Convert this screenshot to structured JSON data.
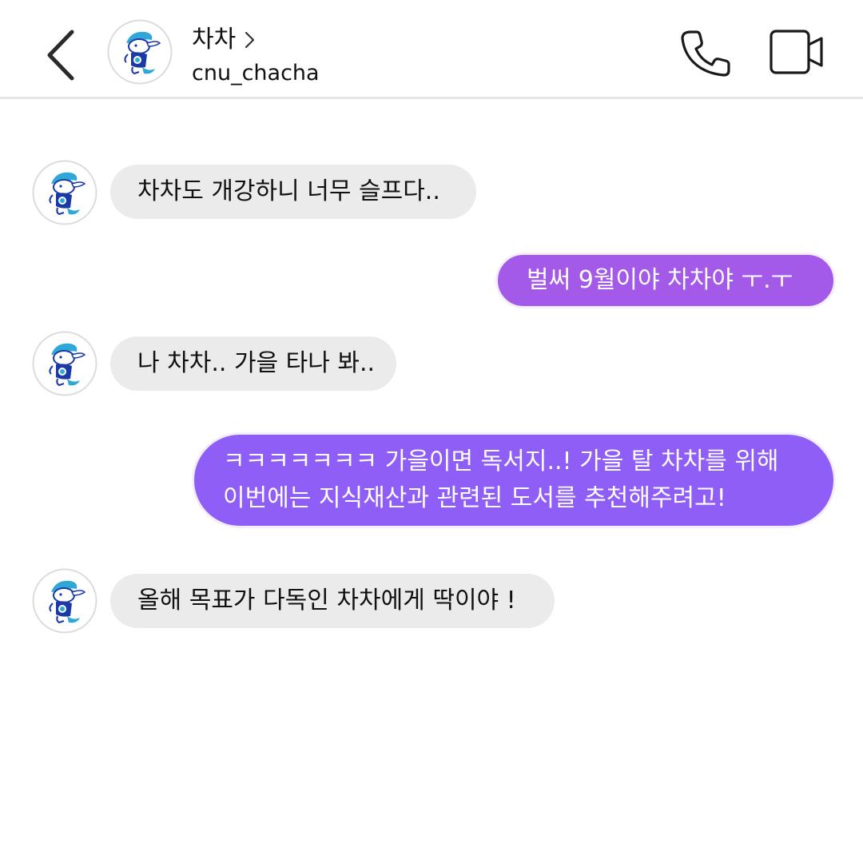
{
  "header": {
    "contact_name": "차차",
    "contact_handle": "cnu_chacha"
  },
  "colors": {
    "outgoing_1": "#a35ae9",
    "outgoing_2": "#8f5ef6",
    "incoming": "#ebebeb",
    "mascot_blue": "#1c3aa6",
    "mascot_teal": "#2fa8d8"
  },
  "icons": {
    "back": "chevron-left-icon",
    "name_chevron": "chevron-right-icon",
    "call": "phone-icon",
    "video": "video-camera-icon",
    "avatar": "mascot-avatar"
  },
  "messages": [
    {
      "sender": "contact",
      "text": "차차도 개강하니 너무 슬프다.."
    },
    {
      "sender": "me",
      "text": "벌써 9월이야 차차야 ㅜ.ㅜ"
    },
    {
      "sender": "contact",
      "text": "나 차차.. 가을 타나 봐.."
    },
    {
      "sender": "me",
      "lines": [
        "ㅋㅋㅋㅋㅋㅋㅋ 가을이면 독서지..! 가을 탈 차차를 위해",
        "이번에는 지식재산과 관련된 도서를 추천해주려고!"
      ]
    },
    {
      "sender": "contact",
      "text": "올해 목표가 다독인 차차에게 딱이야 !"
    }
  ]
}
